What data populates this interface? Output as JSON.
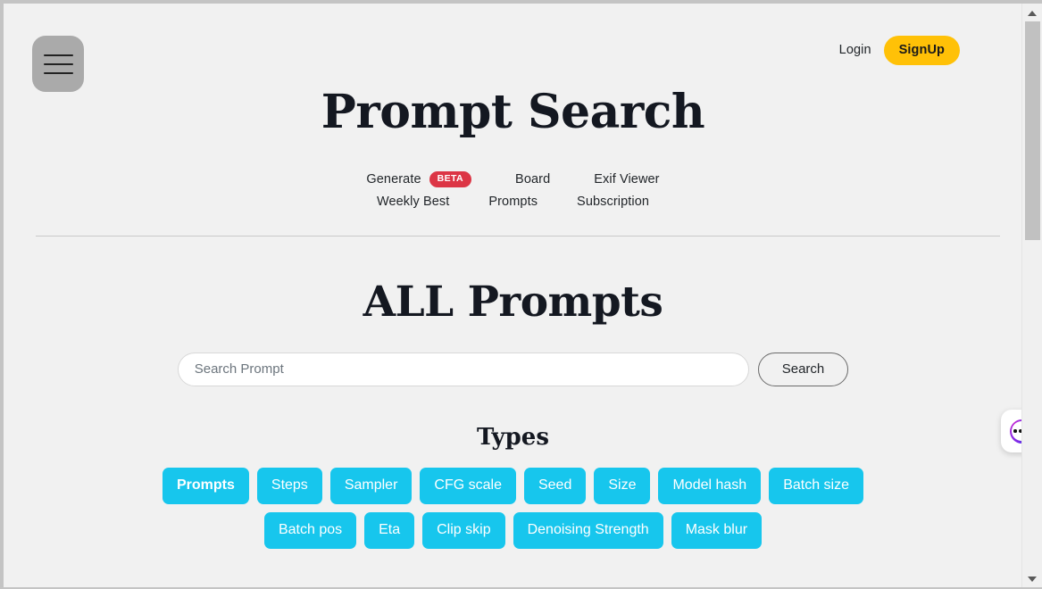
{
  "header": {
    "menu_button_label": "Menu",
    "login_label": "Login",
    "signup_label": "SignUp"
  },
  "site": {
    "title": "Prompt Search"
  },
  "nav": {
    "rows": [
      [
        {
          "label": "Generate",
          "badge": "BETA"
        },
        {
          "label": "Board",
          "badge": null
        },
        {
          "label": "Exif Viewer",
          "badge": null
        }
      ],
      [
        {
          "label": "Weekly Best",
          "badge": null
        },
        {
          "label": "Prompts",
          "badge": null
        },
        {
          "label": "Subscription",
          "badge": null
        }
      ]
    ]
  },
  "main": {
    "section_title": "ALL Prompts",
    "search": {
      "value": "",
      "placeholder": "Search Prompt",
      "button_label": "Search"
    },
    "types": {
      "title": "Types",
      "tags": [
        {
          "label": "Prompts",
          "active": true
        },
        {
          "label": "Steps",
          "active": false
        },
        {
          "label": "Sampler",
          "active": false
        },
        {
          "label": "CFG scale",
          "active": false
        },
        {
          "label": "Seed",
          "active": false
        },
        {
          "label": "Size",
          "active": false
        },
        {
          "label": "Model hash",
          "active": false
        },
        {
          "label": "Batch size",
          "active": false
        },
        {
          "label": "Batch pos",
          "active": false
        },
        {
          "label": "Eta",
          "active": false
        },
        {
          "label": "Clip skip",
          "active": false
        },
        {
          "label": "Denoising Strength",
          "active": false
        },
        {
          "label": "Mask blur",
          "active": false
        }
      ]
    }
  },
  "widgets": {
    "chat_launcher": "chat-launcher"
  },
  "colors": {
    "page_background": "#f1f1f1",
    "accent_cyan": "#17c6ed",
    "signup_amber": "#ffc107",
    "beta_red": "#dc3545",
    "text_dark": "#212529",
    "heading_dark": "#141821",
    "scrollbar_thumb": "#c1c1c1"
  }
}
